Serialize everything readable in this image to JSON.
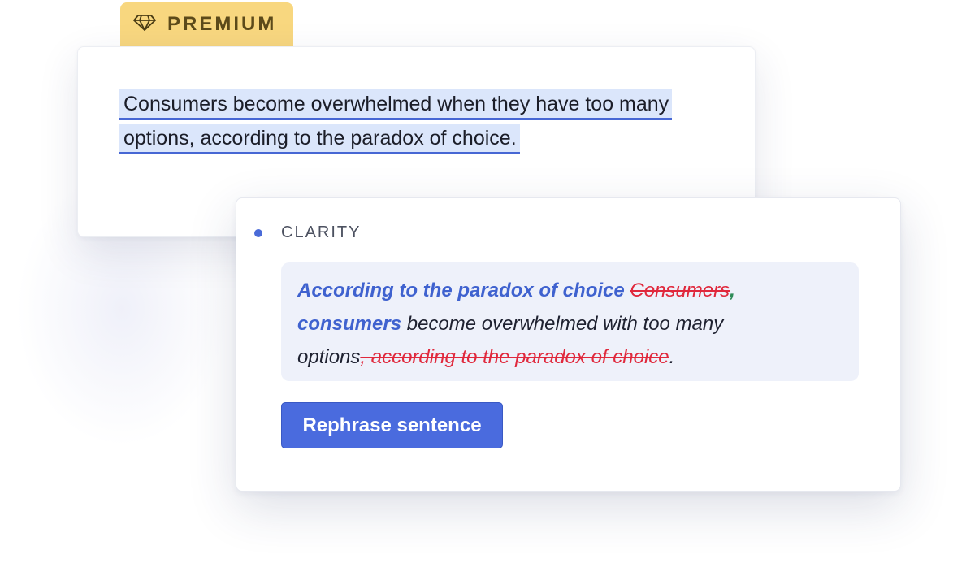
{
  "badge": {
    "label": "PREMIUM",
    "icon": "diamond-icon",
    "color": "#f8d77f"
  },
  "document": {
    "lines": [
      "Consumers become overwhelmed when they have too many",
      "options, according to the paradox of choice."
    ],
    "highlight_color": "#dbe6fb",
    "underline_color": "#4767d4"
  },
  "suggestion": {
    "category": "CLARITY",
    "category_color": "#4a6bd8",
    "insert_phrase": "According to the paradox of choice",
    "deleted_word": "Consumers",
    "inserted_comma": ",",
    "inserted_word": "consumers",
    "kept_middle": " become overwhelmed with too many",
    "kept_options": "options",
    "deleted_clause": ", according to the paradox of choice",
    "end_period": ".",
    "insert_color": "#3f62cf",
    "delete_color": "#e0283c"
  },
  "action": {
    "label": "Rephrase sentence",
    "color": "#4a6bde"
  }
}
